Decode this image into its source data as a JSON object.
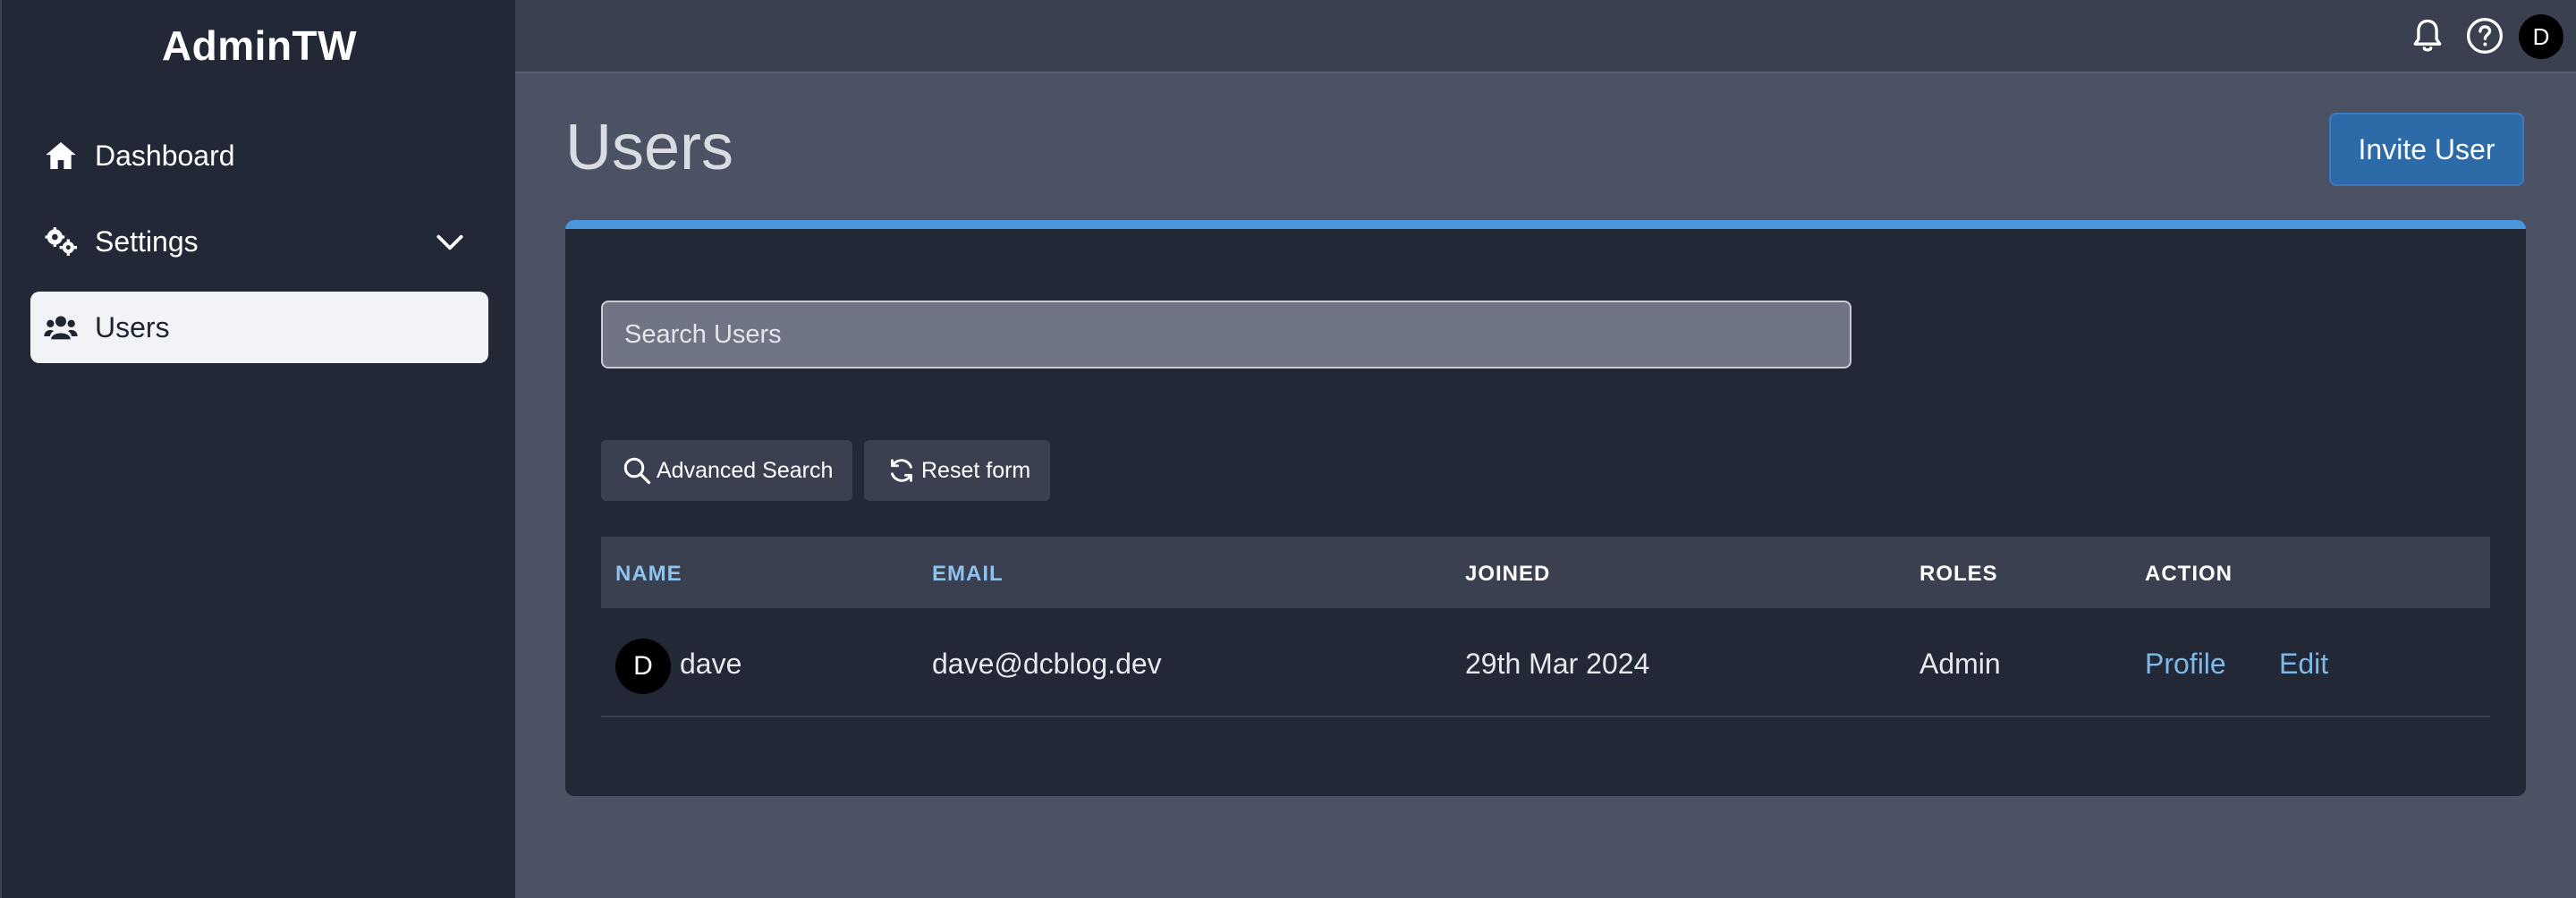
{
  "sidebar": {
    "brand": "AdminTW",
    "items": [
      {
        "label": "Dashboard",
        "icon": "home-icon"
      },
      {
        "label": "Settings",
        "icon": "gears-icon"
      },
      {
        "label": "Users",
        "icon": "users-icon",
        "active": true
      }
    ]
  },
  "topbar": {
    "avatar_initial": "D",
    "icons": [
      "bell-icon",
      "help-icon"
    ]
  },
  "main": {
    "title": "Users",
    "invite_label": "Invite User",
    "search_placeholder": "Search Users",
    "buttons": {
      "advanced_search": "Advanced Search",
      "reset_form": "Reset form"
    },
    "table": {
      "columns": [
        "NAME",
        "EMAIL",
        "JOINED",
        "ROLES",
        "ACTION"
      ],
      "rows": [
        {
          "avatar_initial": "D",
          "name": "dave",
          "email": "dave@dcblog.dev",
          "joined": "29th Mar 2024",
          "roles": "Admin",
          "actions": [
            "Profile",
            "Edit"
          ]
        }
      ]
    }
  },
  "colors": {
    "sidebar_bg": "#232836",
    "accent": "#4a97de",
    "invite_button": "#2c6aa8",
    "link": "#7db8e8"
  }
}
